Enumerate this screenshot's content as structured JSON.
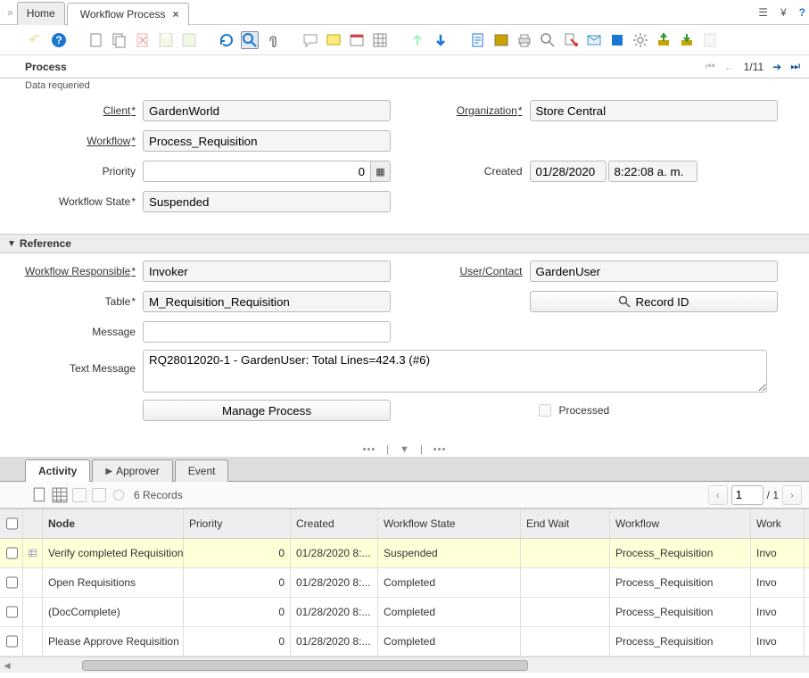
{
  "top_tabs": {
    "home": "Home",
    "active_title": "Workflow Process"
  },
  "section": {
    "title": "Process",
    "status": "Data requeried",
    "counter": "1/11"
  },
  "labels": {
    "client": "Client",
    "organization": "Organization",
    "workflow": "Workflow",
    "priority": "Priority",
    "created": "Created",
    "workflow_state": "Workflow State",
    "reference": "Reference",
    "workflow_responsible": "Workflow Responsible",
    "user_contact": "User/Contact",
    "table": "Table",
    "message": "Message",
    "text_message": "Text Message",
    "processed": "Processed"
  },
  "buttons": {
    "record_id": "Record ID",
    "manage_process": "Manage Process"
  },
  "form": {
    "client": "GardenWorld",
    "organization": "Store Central",
    "workflow": "Process_Requisition",
    "priority": "0",
    "created_date": "01/28/2020",
    "created_time": "8:22:08 a. m.",
    "workflow_state": "Suspended",
    "workflow_responsible": "Invoker",
    "user_contact": "GardenUser",
    "table": "M_Requisition_Requisition",
    "message": "",
    "text_message": "RQ28012020-1 - GardenUser: Total Lines=424.3 (#6)",
    "processed": false
  },
  "detail_tabs": {
    "activity": "Activity",
    "approver": "Approver",
    "event": "Event"
  },
  "detail": {
    "records_label": "6 Records",
    "page": "1",
    "page_total": "/ 1",
    "columns": {
      "node": "Node",
      "priority": "Priority",
      "created": "Created",
      "workflow_state": "Workflow State",
      "end_wait": "End Wait",
      "workflow": "Workflow",
      "workflow_resp": "Work"
    },
    "rows": [
      {
        "node": "Verify completed Requisition",
        "priority": "0",
        "created": "01/28/2020 8:...",
        "state": "Suspended",
        "end_wait": "",
        "workflow": "Process_Requisition",
        "wfresp": "Invo",
        "highlight": true,
        "has_icon": true
      },
      {
        "node": "Open Requisitions",
        "priority": "0",
        "created": "01/28/2020 8:...",
        "state": "Completed",
        "end_wait": "",
        "workflow": "Process_Requisition",
        "wfresp": "Invo",
        "highlight": false,
        "has_icon": false
      },
      {
        "node": "(DocComplete)",
        "priority": "0",
        "created": "01/28/2020 8:...",
        "state": "Completed",
        "end_wait": "",
        "workflow": "Process_Requisition",
        "wfresp": "Invo",
        "highlight": false,
        "has_icon": false
      },
      {
        "node": "Please Approve Requisition",
        "priority": "0",
        "created": "01/28/2020 8:...",
        "state": "Completed",
        "end_wait": "",
        "workflow": "Process_Requisition",
        "wfresp": "Invo",
        "highlight": false,
        "has_icon": false
      }
    ]
  }
}
